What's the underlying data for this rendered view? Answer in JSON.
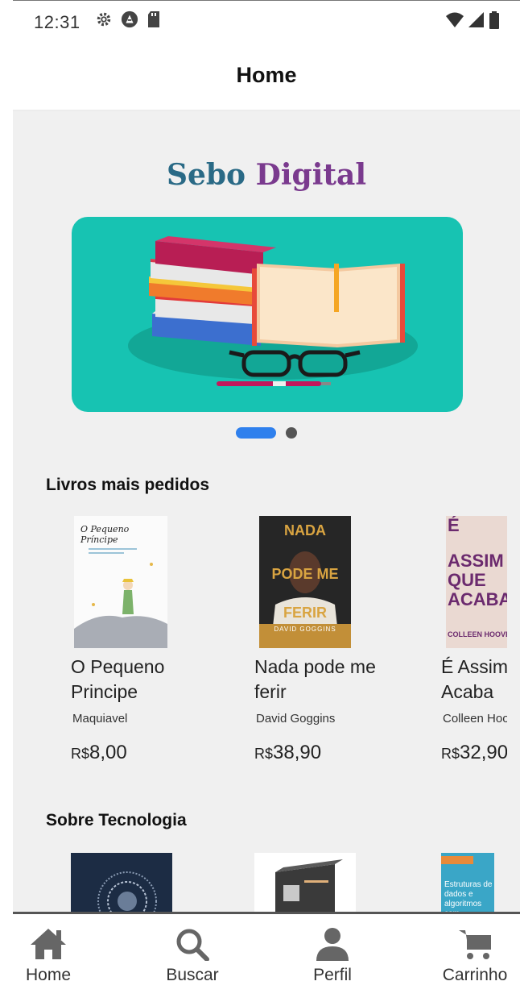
{
  "status": {
    "time": "12:31",
    "icons_left": [
      "gear-icon",
      "android-icon",
      "sd-card-icon"
    ],
    "icons_right": [
      "wifi-icon",
      "signal-icon",
      "battery-icon"
    ]
  },
  "appbar": {
    "title": "Home"
  },
  "logo": {
    "part1": "Sebo",
    "part2": "Digital"
  },
  "carousel": {
    "dots": 2,
    "active": 0
  },
  "section1": {
    "title": "Livros mais pedidos",
    "books": [
      {
        "title": "O Pequeno Principe",
        "author": "Maquiavel",
        "currency": "R$",
        "price": "8,00"
      },
      {
        "title": "Nada pode me ferir",
        "author": "David Goggins",
        "currency": "R$",
        "price": "38,90"
      },
      {
        "title": "É Assim que Acaba",
        "author": "Colleen Hoover",
        "currency": "R$",
        "price": "32,90"
      }
    ]
  },
  "covers": {
    "nada_1": "NADA",
    "nada_2": "PODE ME",
    "nada_3": "FERIR",
    "nada_author": "DAVID GOGGINS",
    "assim_1": "É",
    "assim_2": "ASSIM",
    "assim_3": "QUE",
    "assim_4": "ACABA",
    "assim_author": "COLLEEN HOOVER",
    "principe": "O Pequeno Príncipe",
    "tech3_label": "Estruturas de dados e algoritmos com JavaScript"
  },
  "section2": {
    "title": "Sobre Tecnologia"
  },
  "nav": {
    "home": "Home",
    "search": "Buscar",
    "profile": "Perfil",
    "cart": "Carrinho"
  },
  "colors": {
    "accent": "#2f80ed",
    "banner": "#17c3b2",
    "logo_blue": "#2a6a86",
    "logo_purple": "#7a3a8e"
  }
}
